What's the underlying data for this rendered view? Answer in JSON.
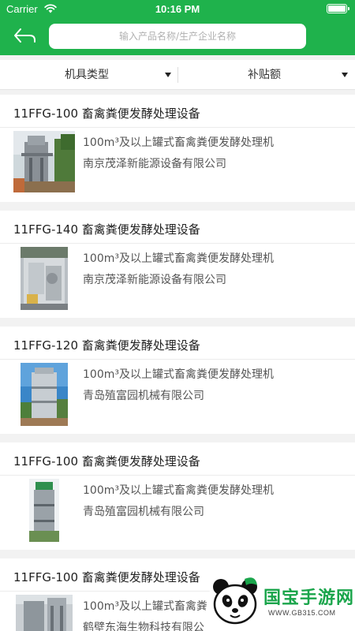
{
  "status_bar": {
    "carrier": "Carrier",
    "time": "10:16 PM"
  },
  "nav": {
    "search_placeholder": "输入产品名称/生产企业名称"
  },
  "filters": [
    {
      "label": "机具类型"
    },
    {
      "label": "补贴额"
    }
  ],
  "products": [
    {
      "title": "11FFG-100 畜禽粪便发酵处理设备",
      "description": "100m³及以上罐式畜禽粪便发酵处理机",
      "company": "南京茂泽新能源设备有限公司"
    },
    {
      "title": "11FFG-140 畜禽粪便发酵处理设备",
      "description": "100m³及以上罐式畜禽粪便发酵处理机",
      "company": "南京茂泽新能源设备有限公司"
    },
    {
      "title": "11FFG-120 畜禽粪便发酵处理设备",
      "description": "100m³及以上罐式畜禽粪便发酵处理机",
      "company": "青岛殖富园机械有限公司"
    },
    {
      "title": "11FFG-100 畜禽粪便发酵处理设备",
      "description": "100m³及以上罐式畜禽粪便发酵处理机",
      "company": "青岛殖富园机械有限公司"
    },
    {
      "title": "11FFG-100 畜禽粪便发酵处理设备",
      "description": "100m³及以上罐式畜禽粪便发酵处理机",
      "company": "鹤壁东海生物科技有限公司"
    }
  ],
  "watermark": {
    "brand": "国宝手游网",
    "url": "WWW.GB315.COM"
  },
  "colors": {
    "brand_green": "#1fb24c",
    "watermark_green": "#1aa54b"
  }
}
